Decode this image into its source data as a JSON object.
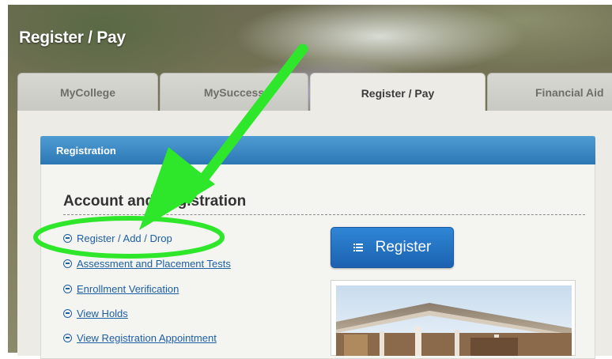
{
  "header": {
    "title": "Register / Pay"
  },
  "tabs": [
    {
      "label": "MyCollege"
    },
    {
      "label": "MySuccess"
    },
    {
      "label": "Register / Pay",
      "active": true
    },
    {
      "label": "Financial Aid"
    }
  ],
  "panel": {
    "title": "Registration"
  },
  "section": {
    "heading": "Account and Registration"
  },
  "links": [
    {
      "label": "Register / Add / Drop"
    },
    {
      "label": "Assessment and Placement Tests"
    },
    {
      "label": "Enrollment Verification"
    },
    {
      "label": "View Holds"
    },
    {
      "label": "View Registration Appointment"
    }
  ],
  "register_button": {
    "label": "Register",
    "icon": "list-icon"
  },
  "photo": {
    "icon": "campus-building-photo"
  },
  "annotation": {
    "color": "#2ee62a",
    "arrow_icon": "green-arrow-icon",
    "ellipse_icon": "green-ellipse-highlight"
  },
  "colors": {
    "header_blue": "#2c78b5",
    "link_blue": "#1d5fa4",
    "button_blue": "#1b62b0"
  }
}
